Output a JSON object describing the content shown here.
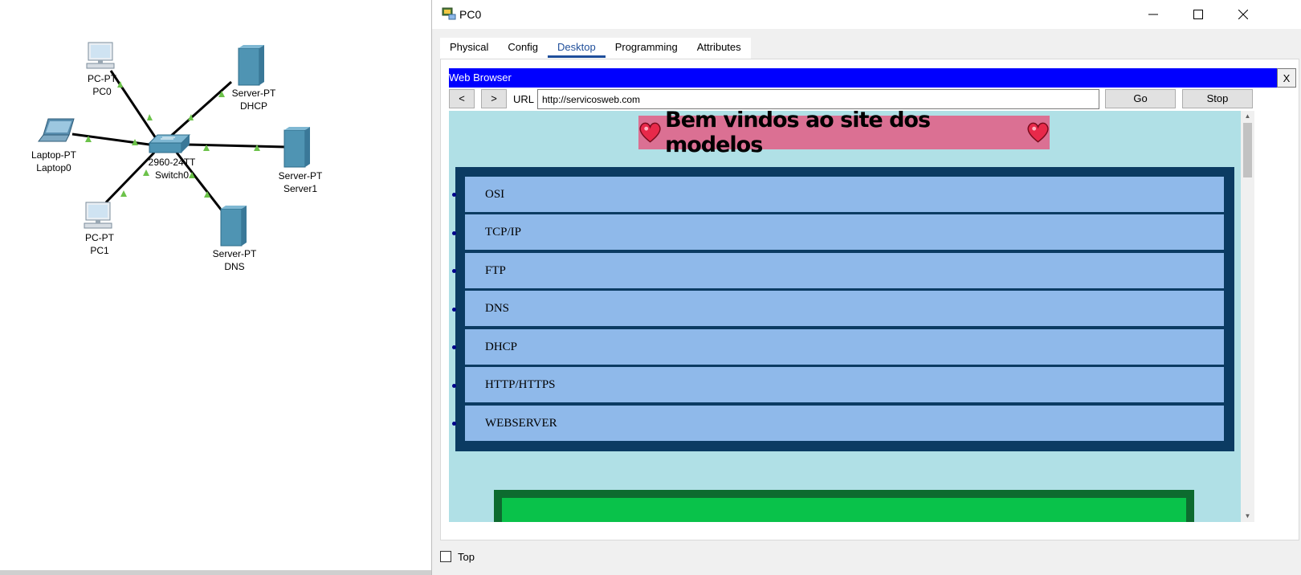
{
  "topology": {
    "nodes": [
      {
        "id": "pc0",
        "type": "PC-PT",
        "name": "PC0"
      },
      {
        "id": "dhcp",
        "type": "Server-PT",
        "name": "DHCP"
      },
      {
        "id": "laptop0",
        "type": "Laptop-PT",
        "name": "Laptop0"
      },
      {
        "id": "switch0",
        "type": "2960-24TT",
        "name": "Switch0"
      },
      {
        "id": "server1",
        "type": "Server-PT",
        "name": "Server1"
      },
      {
        "id": "pc1",
        "type": "PC-PT",
        "name": "PC1"
      },
      {
        "id": "dns",
        "type": "Server-PT",
        "name": "DNS"
      }
    ],
    "link_color": "#000000",
    "link_status_color": "#6cc24a"
  },
  "window": {
    "title": "PC0",
    "minimize_icon": "minimize-icon",
    "maximize_icon": "maximize-icon",
    "close_icon": "close-icon",
    "tabs": [
      "Physical",
      "Config",
      "Desktop",
      "Programming",
      "Attributes"
    ],
    "active_tab": "Desktop",
    "top_checkbox_label": "Top",
    "top_checked": false
  },
  "browser": {
    "title": "Web Browser",
    "close_label": "X",
    "back_label": "<",
    "forward_label": ">",
    "url_label": "URL",
    "url_value": "http://servicosweb.com",
    "go_label": "Go",
    "stop_label": "Stop",
    "title_color": "#0000ff"
  },
  "page": {
    "background": "#b0e0e6",
    "heading": "Bem vindos ao site dos modelos",
    "heading_bg": "#db7093",
    "heading_icon": "heart-icon",
    "menu_items": [
      "OSI",
      "TCP/IP",
      "FTP",
      "DNS",
      "DHCP",
      "HTTP/HTTPS",
      "WEBSERVER"
    ],
    "menu_border_color": "#0b3b62",
    "menu_item_color": "#8fb9ea",
    "footer_box_color": "#09c24a"
  }
}
